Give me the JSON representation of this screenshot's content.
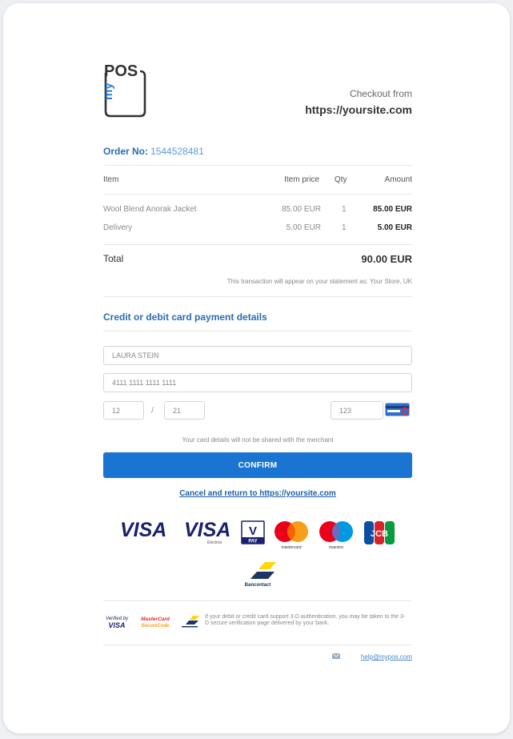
{
  "logo": {
    "text_top": "POS",
    "text_side": "my"
  },
  "header": {
    "checkout_from": "Checkout from",
    "site": "https://yoursite.com"
  },
  "order": {
    "label": "Order No:",
    "number": "1544528481"
  },
  "table": {
    "headers": [
      "Item",
      "Item price",
      "Qty",
      "Amount"
    ],
    "rows": [
      {
        "item": "Wool Blend Anorak Jacket",
        "price": "85.00 EUR",
        "qty": "1",
        "amount": "85.00 EUR"
      },
      {
        "item": "Delivery",
        "price": "5.00 EUR",
        "qty": "1",
        "amount": "5.00 EUR"
      }
    ],
    "total_label": "Total",
    "total_value": "90.00 EUR",
    "statement": "This transaction will appear on your statement as: Your Store, UK"
  },
  "payment": {
    "title": "Credit or debit card payment details",
    "cardholder": "LAURA STEIN",
    "card_number": "4111 1111 1111 1111",
    "exp_month": "12",
    "exp_separator": "/",
    "exp_year": "21",
    "cvc": "123",
    "privacy_note": "Your card details will not be shared with the merchant",
    "confirm_label": "CONFIRM",
    "cancel_link": "Cancel and return to https://yoursite.com"
  },
  "card_logos": {
    "visa": "VISA",
    "visa_electron": "VISA",
    "visa_electron_sub": "Electron",
    "vpay": "V",
    "vpay_sub": "PAY",
    "mastercard_sub": "mastercard",
    "maestro_sub": "maestro",
    "jcb": "JCB",
    "bancontact_sub": "Bancontact"
  },
  "secure": {
    "verified_by": "Verified by",
    "verified_visa": "VISA",
    "mc_secure_line1": "MasterCard",
    "mc_secure_line2": "SecureCode",
    "info": "If your debit or credit card support 3-D authentication, you may be taken to the 3-D secure verification page delivered by your bank.",
    "help_email": "help@mypos.com"
  },
  "colors": {
    "accent": "#1a74d1",
    "title_blue": "#2a6cb0",
    "visa_navy": "#1a1f71",
    "mc_red": "#eb001b",
    "mc_orange": "#f79e1b",
    "maestro_blue": "#0099df"
  }
}
